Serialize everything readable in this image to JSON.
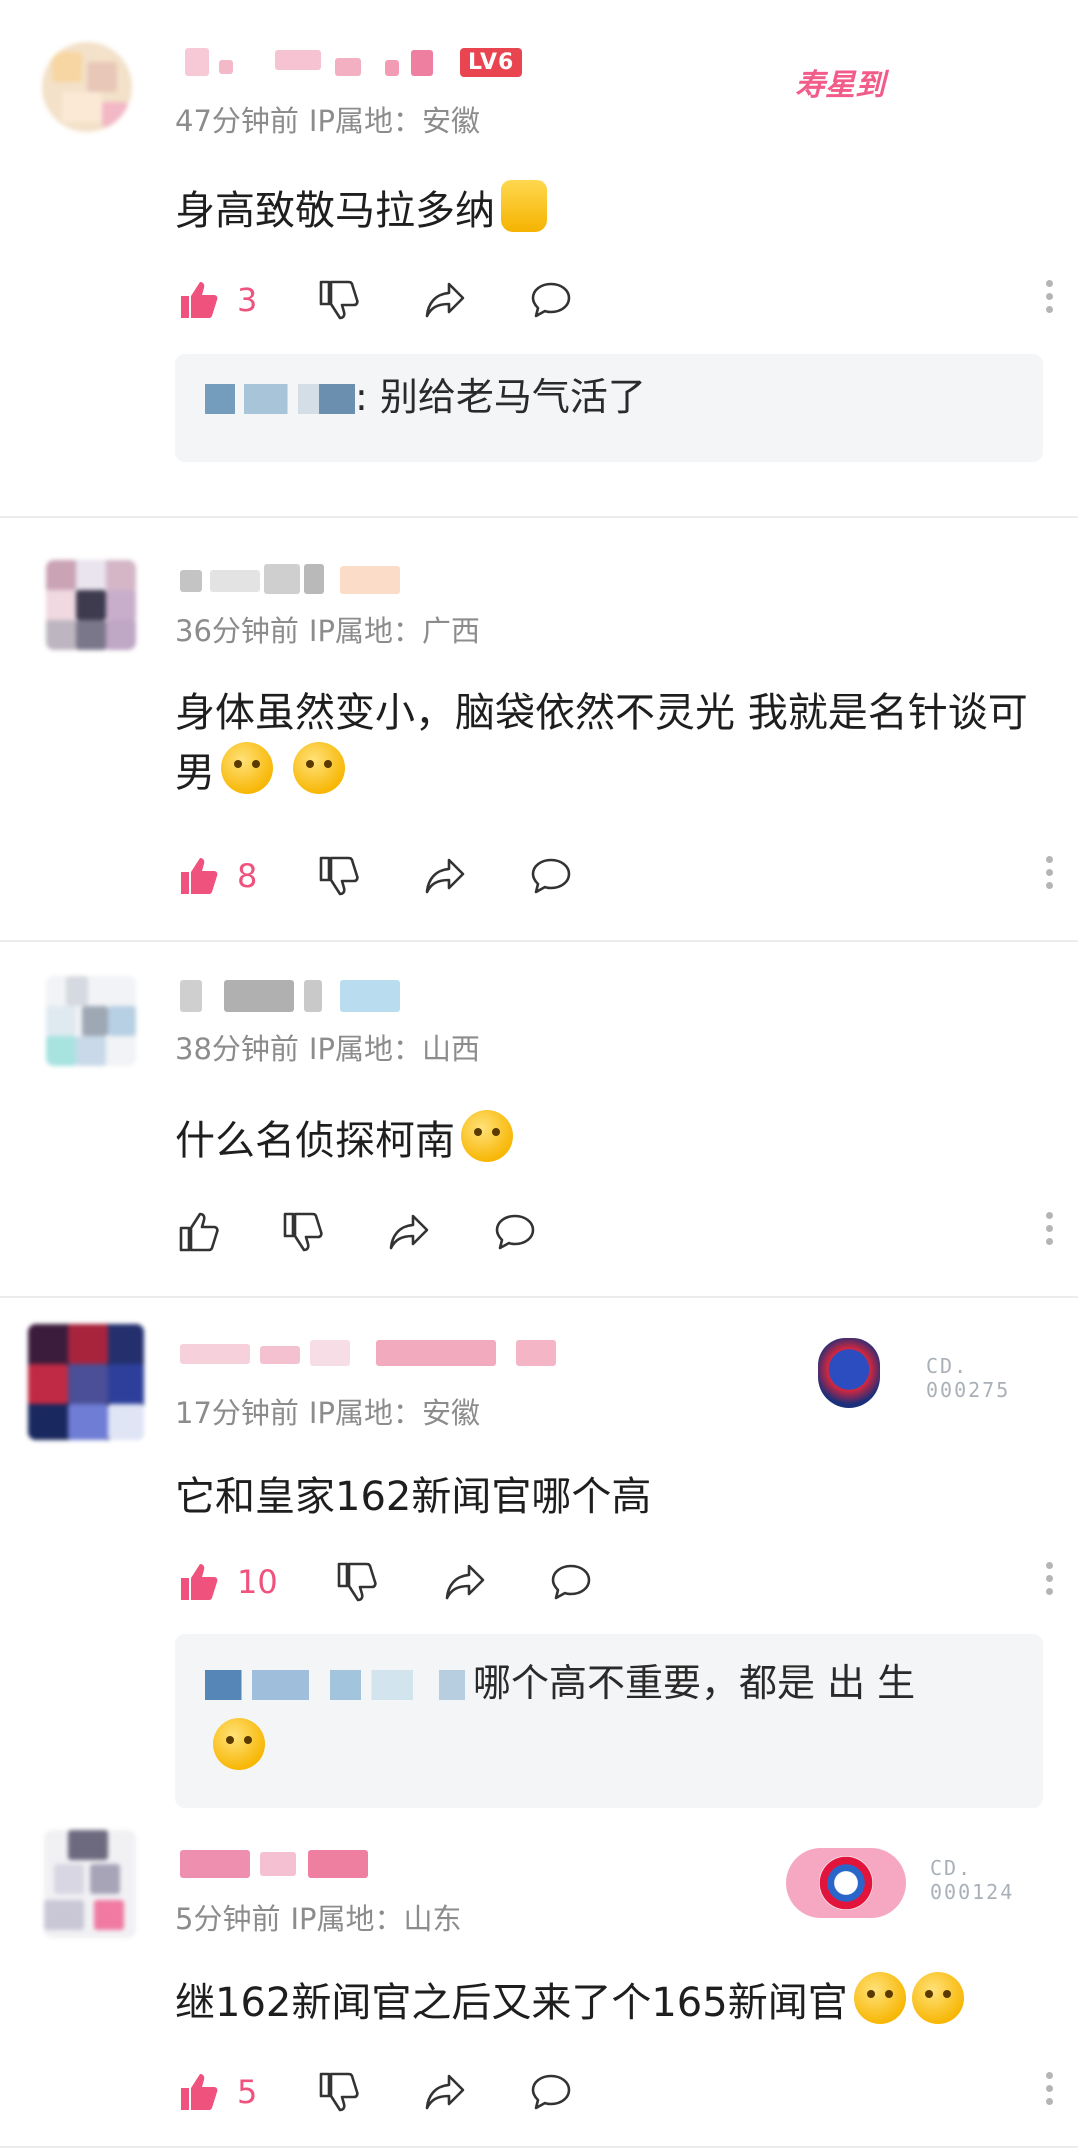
{
  "comments": [
    {
      "time": "47分钟前",
      "ip": "IP属地：安徽",
      "level": "LV6",
      "sign": "寿星到",
      "text": "身高致敬马拉多纳",
      "likes": "3",
      "reply_text": ": 别给老马气活了"
    },
    {
      "time": "36分钟前",
      "ip": "IP属地：广西",
      "text": "身体虽然变小，脑袋依然不灵光 我就是名针谈可男",
      "likes": "8"
    },
    {
      "time": "38分钟前",
      "ip": "IP属地：山西",
      "text": "什么名侦探柯南",
      "likes": ""
    },
    {
      "time": "17分钟前",
      "ip": "IP属地：安徽",
      "badge_code": [
        "CD.",
        "000275"
      ],
      "text": "它和皇家162新闻官哪个高",
      "likes": "10",
      "reply_text": "哪个高不重要，都是 出 生"
    },
    {
      "time": "5分钟前",
      "ip": "IP属地：山东",
      "badge_code": [
        "CD.",
        "000124"
      ],
      "text": "继162新闻官之后又来了个165新闻官",
      "likes": "5"
    }
  ],
  "colors": {
    "like_active": "#f0527e",
    "meta_gray": "#8c8c8c",
    "reply_bg": "#f4f5f7",
    "divider": "#ececec"
  },
  "icons": [
    "thumb-up-icon",
    "thumb-down-icon",
    "share-icon",
    "comment-icon",
    "more-icon"
  ]
}
